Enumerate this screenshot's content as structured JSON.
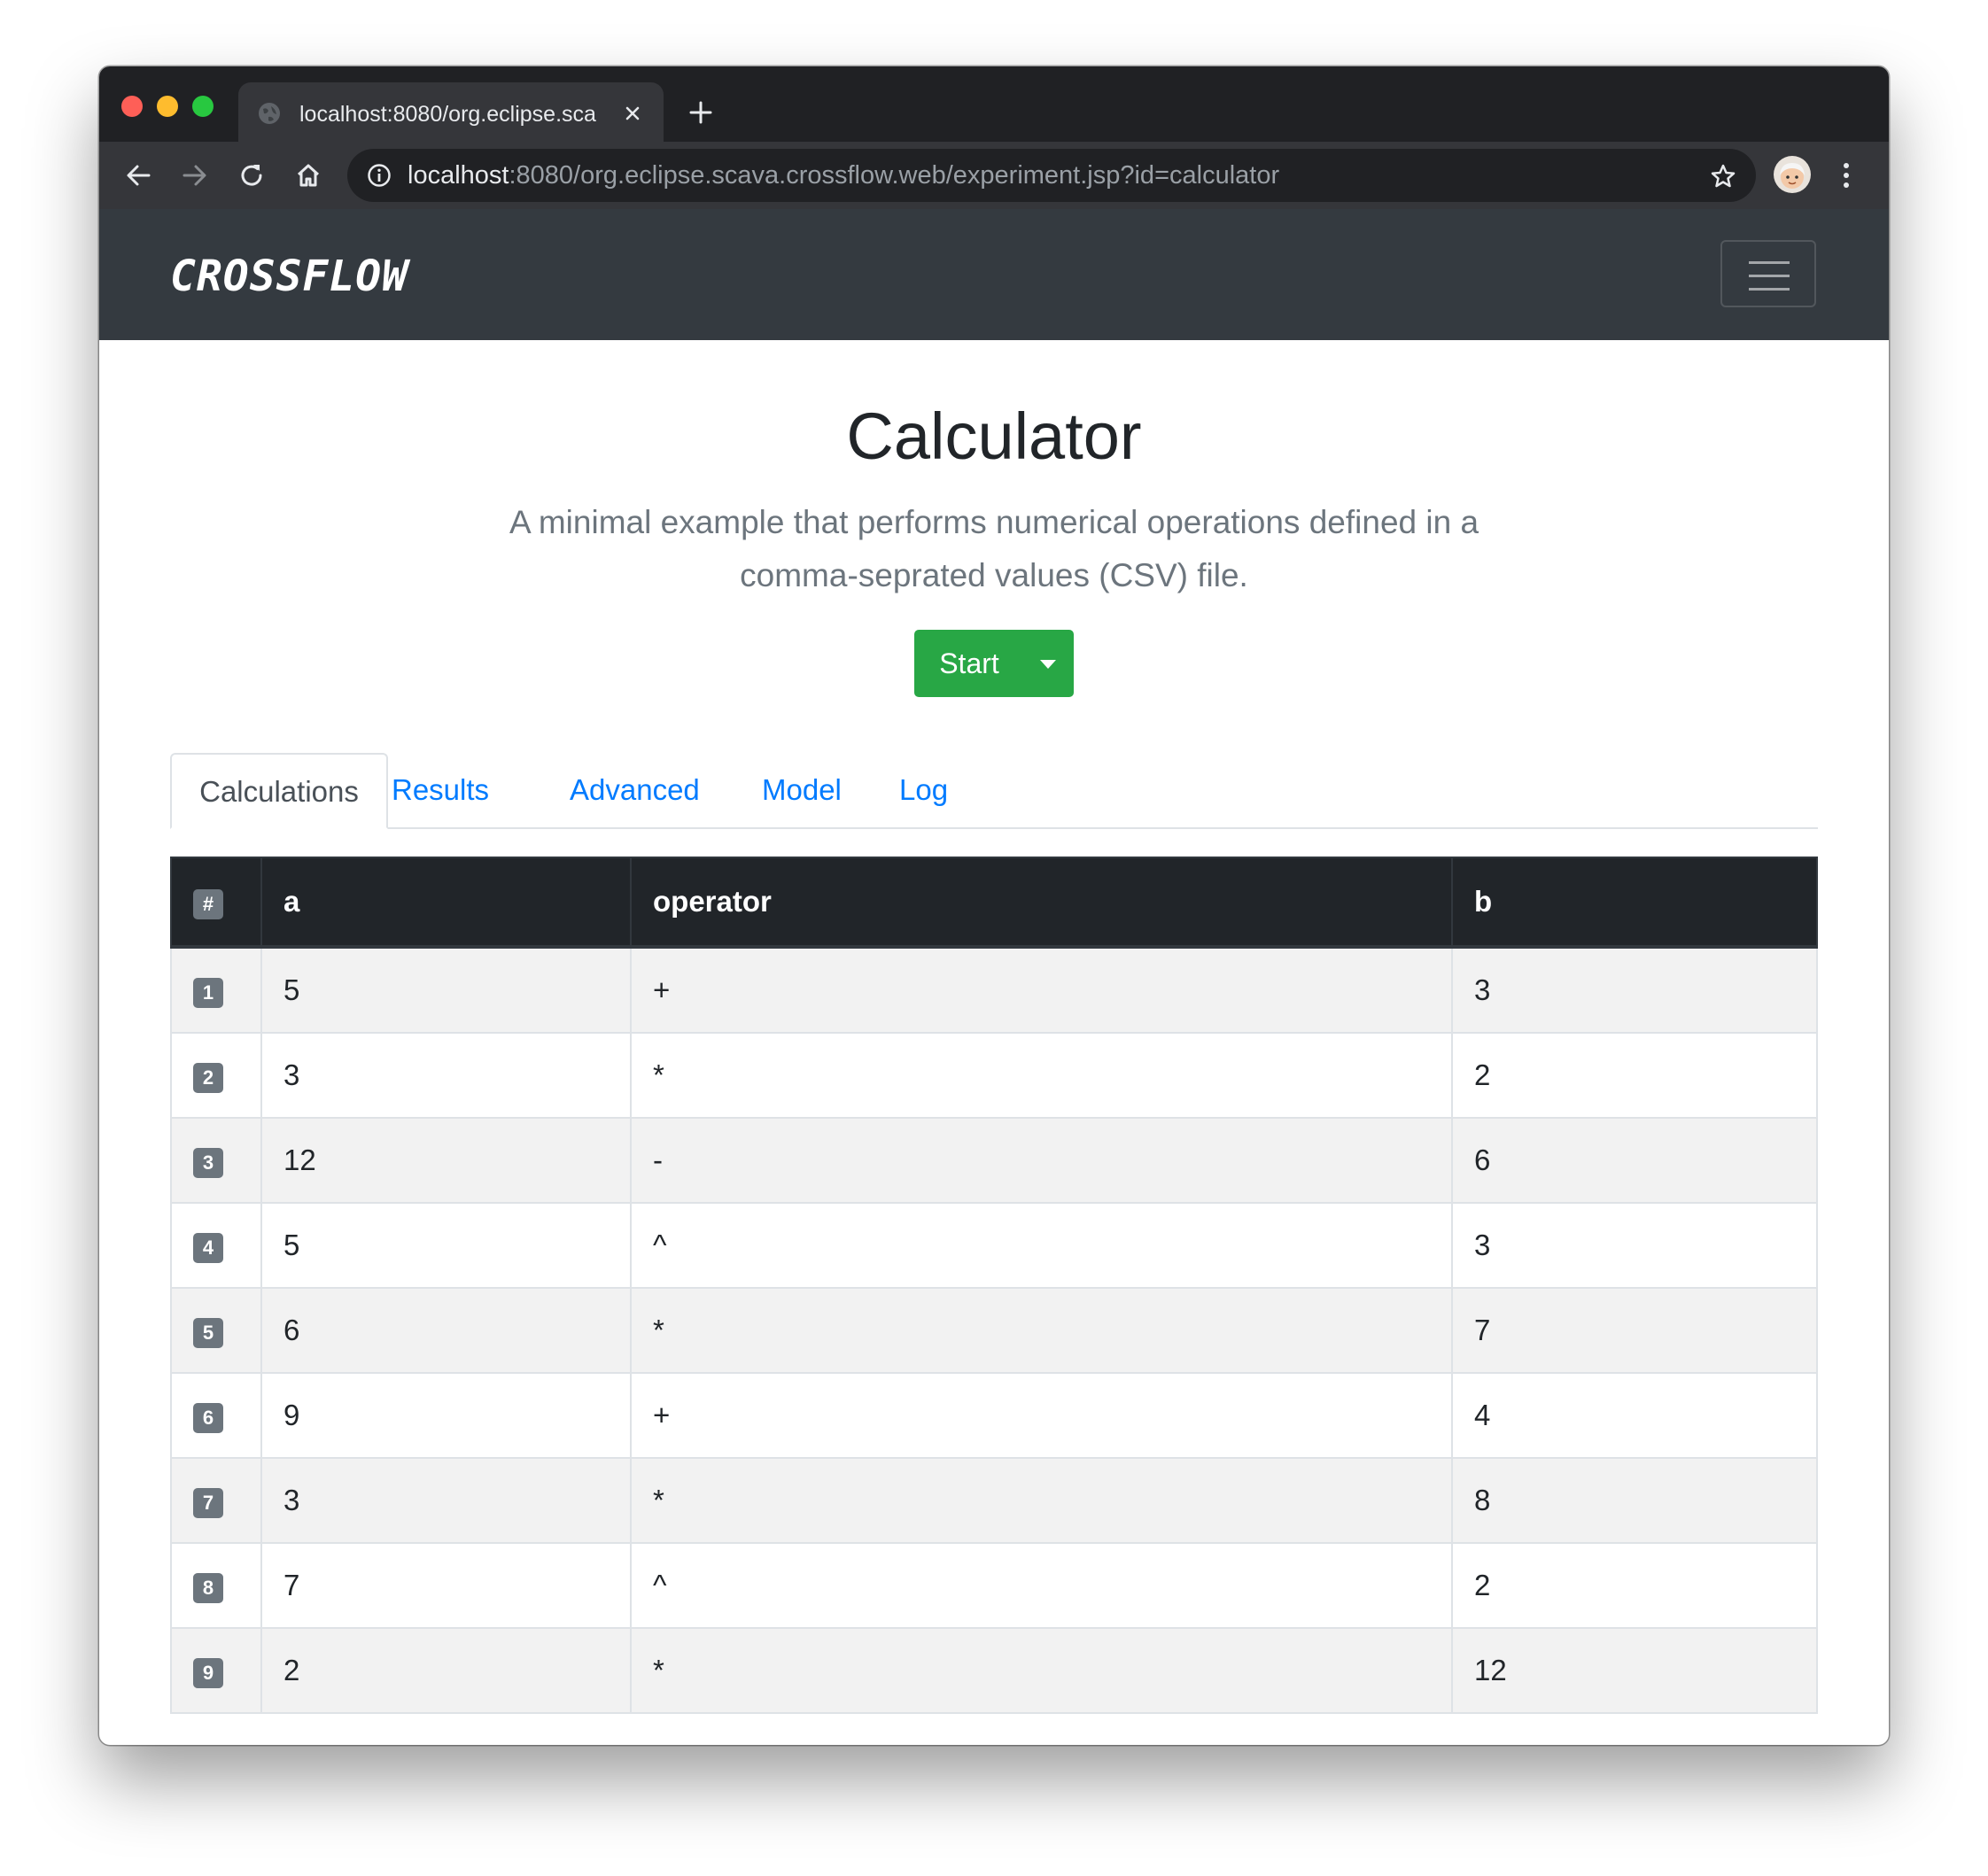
{
  "browser": {
    "tab_title": "localhost:8080/org.eclipse.sca",
    "url_host": "localhost",
    "url_rest": ":8080/org.eclipse.scava.crossflow.web/experiment.jsp?id=calculator"
  },
  "navbar": {
    "brand": "CROSSFLOW"
  },
  "page": {
    "title": "Calculator",
    "lead": "A minimal example that performs numerical operations defined in a comma-seprated values (CSV) file.",
    "start_label": "Start"
  },
  "tabs": [
    {
      "label": "Calculations",
      "active": true
    },
    {
      "label": "Results",
      "active": false
    },
    {
      "label": "Advanced",
      "active": false
    },
    {
      "label": "Model",
      "active": false
    },
    {
      "label": "Log",
      "active": false
    }
  ],
  "table": {
    "headers": [
      "#",
      "a",
      "operator",
      "b"
    ],
    "rows": [
      {
        "n": "1",
        "a": "5",
        "op": "+",
        "b": "3"
      },
      {
        "n": "2",
        "a": "3",
        "op": "*",
        "b": "2"
      },
      {
        "n": "3",
        "a": "12",
        "op": "-",
        "b": "6"
      },
      {
        "n": "4",
        "a": "5",
        "op": "^",
        "b": "3"
      },
      {
        "n": "5",
        "a": "6",
        "op": "*",
        "b": "7"
      },
      {
        "n": "6",
        "a": "9",
        "op": "+",
        "b": "4"
      },
      {
        "n": "7",
        "a": "3",
        "op": "*",
        "b": "8"
      },
      {
        "n": "8",
        "a": "7",
        "op": "^",
        "b": "2"
      },
      {
        "n": "9",
        "a": "2",
        "op": "*",
        "b": "12"
      }
    ]
  },
  "colors": {
    "navbar_bg": "#343a40",
    "success": "#28a745",
    "link": "#007bff",
    "table_head_bg": "#212529",
    "badge_bg": "#6c757d"
  },
  "icons": [
    "globe-icon",
    "close-icon",
    "plus-icon",
    "back-icon",
    "forward-icon",
    "reload-icon",
    "home-icon",
    "info-icon",
    "star-icon",
    "avatar",
    "menu-dots-icon",
    "hamburger-icon",
    "caret-down-icon"
  ]
}
